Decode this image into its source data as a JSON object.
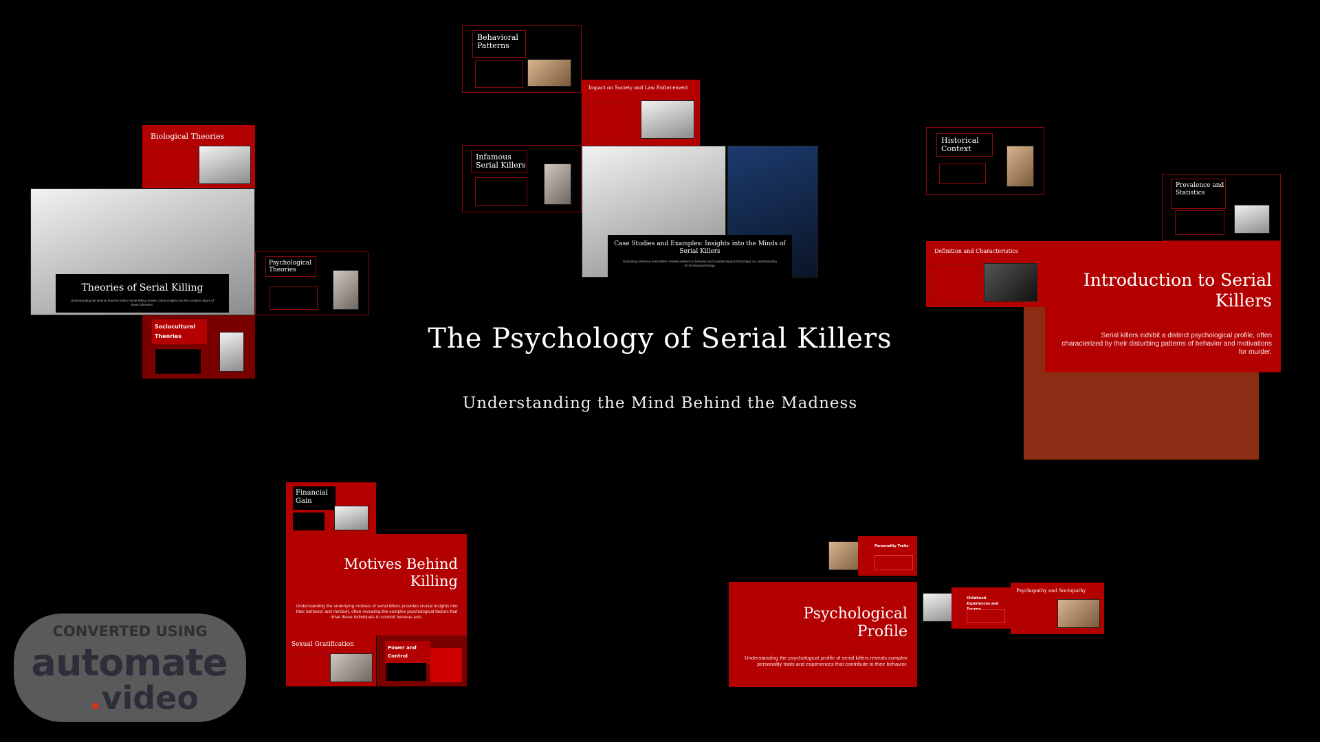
{
  "main": {
    "title": "The Psychology of Serial Killers",
    "subtitle": "Understanding the Mind Behind the Madness"
  },
  "frames": {
    "behavioral_patterns": {
      "title": "Behavioral Patterns"
    },
    "impact": {
      "title": "Impact on Society and Law Enforcement"
    },
    "infamous": {
      "title": "Infamous Serial Killers"
    },
    "case_studies": {
      "title": "Case Studies and Examples: Insights into the Minds of Serial Killers",
      "body": "Examining infamous serial killers reveals patterns in behavior and societal impacts that shape our understanding of criminal psychology."
    },
    "biological": {
      "title": "Biological Theories"
    },
    "theories": {
      "title": "Theories of Serial Killing",
      "body": "Understanding the diverse theories behind serial killing reveals critical insights into the complex nature of these offenders."
    },
    "psychological_theories": {
      "title": "Psychological Theories"
    },
    "sociocultural": {
      "title": "Sociocultural Theories"
    },
    "historical": {
      "title": "Historical Context"
    },
    "prevalence": {
      "title": "Prevalence and Statistics"
    },
    "definition": {
      "title": "Definition and Characteristics"
    },
    "intro": {
      "title": "Introduction to Serial Killers",
      "body": "Serial killers exhibit a distinct psychological profile, often characterized by their disturbing patterns of behavior and motivations for murder."
    },
    "financial": {
      "title": "Financial Gain"
    },
    "motives": {
      "title": "Motives Behind Killing",
      "body": "Understanding the underlying motives of serial killers provides crucial insights into their behavior and mindset, often revealing the complex psychological factors that drive these individuals to commit heinous acts."
    },
    "sexual": {
      "title": "Sexual Gratification"
    },
    "power": {
      "title": "Power and Control"
    },
    "personality": {
      "title": "Personality Traits"
    },
    "profile": {
      "title": "Psychological Profile",
      "body": "Understanding the psychological profile of serial killers reveals complex personality traits and experiences that contribute to their behavior."
    },
    "childhood": {
      "title": "Childhood Experiences and Trauma"
    },
    "psychopathy": {
      "title": "Psychopathy and Sociopathy"
    }
  },
  "watermark": {
    "line1": "CONVERTED USING",
    "line2": "automate",
    "dot": ".",
    "line3": "video"
  },
  "colors": {
    "background": "#000000",
    "accent_red": "#b30000",
    "rust": "#8b2d14"
  }
}
